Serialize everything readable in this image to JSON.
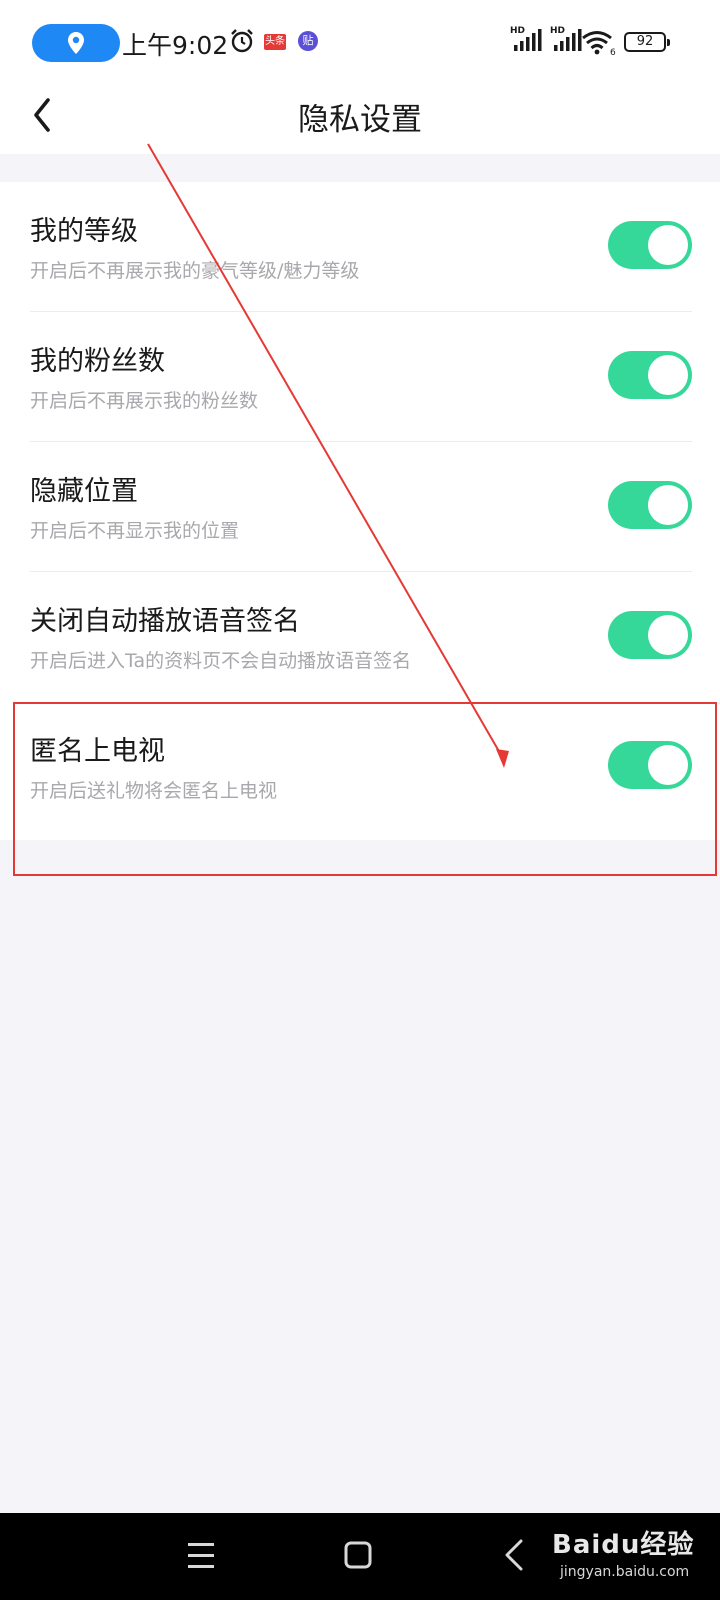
{
  "status_bar": {
    "time": "上午9:02",
    "toutiao_badge": "头条",
    "tieba_badge": "贴",
    "signal_label_1": "HD",
    "signal_label_2": "HD",
    "wifi_sub": "6",
    "battery": "92",
    "location_pill_color": "#1e88f5"
  },
  "header": {
    "title": "隐私设置"
  },
  "settings": {
    "items": [
      {
        "label": "我的等级",
        "desc": "开启后不再展示我的豪气等级/魅力等级",
        "enabled": true
      },
      {
        "label": "我的粉丝数",
        "desc": "开启后不再展示我的粉丝数",
        "enabled": true
      },
      {
        "label": "隐藏位置",
        "desc": "开启后不再显示我的位置",
        "enabled": true
      },
      {
        "label": "关闭自动播放语音签名",
        "desc": "开启后进入Ta的资料页不会自动播放语音签名",
        "enabled": true
      },
      {
        "label": "匿名上电视",
        "desc": "开启后送礼物将会匿名上电视",
        "enabled": true
      }
    ]
  },
  "colors": {
    "toggle_on": "#36d89a",
    "annotation": "#e53935"
  },
  "nav": {
    "menu_icon": "menu-icon",
    "home_icon": "home-icon",
    "back_icon": "back-icon"
  },
  "watermark": {
    "brand": "Baidu经验",
    "url": "jingyan.baidu.com"
  }
}
